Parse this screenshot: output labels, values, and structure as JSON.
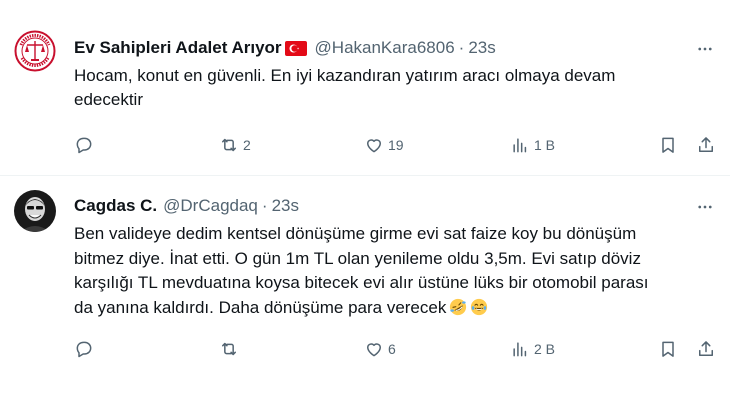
{
  "tweets": [
    {
      "author_name": "Ev Sahipleri Adalet Arıyor",
      "flag": "Turkey",
      "handle": "@HakanKara6806",
      "separator": "·",
      "time": "23s",
      "avatar_text": "EV SAHİPLERİ ADALET ARIYOR",
      "text": "Hocam, konut en güvenli. En iyi kazandıran yatırım aracı olmaya devam edecektir",
      "replies": "",
      "retweets": "2",
      "likes": "19",
      "views": "1 B"
    },
    {
      "author_name": "Cagdas C.",
      "handle": "@DrCagdaq",
      "separator": "·",
      "time": "23s",
      "text": "Ben validEYe dedim",
      "text_full": "Ben valideye dedim kentsel dönüşüme girme evi sat faize koy bu dönüşüm bitmez diye. İnat etti. O gün 1m TL olan yenileme oldu 3,5m. Evi satıp döviz karşılığı TL mevduatına koysa bitecek evi alır üstüne lüks bir otomobil parası da yanına kaldırdı. Daha dönüşüme para verecek",
      "emojis": [
        "rolling-on-floor-laughing",
        "face-with-tears-of-joy"
      ],
      "replies": "",
      "retweets": "",
      "likes": "6",
      "views": "2 B"
    }
  ],
  "colors": {
    "text": "#0f1419",
    "secondary": "#536471",
    "divider": "#eff3f4"
  }
}
